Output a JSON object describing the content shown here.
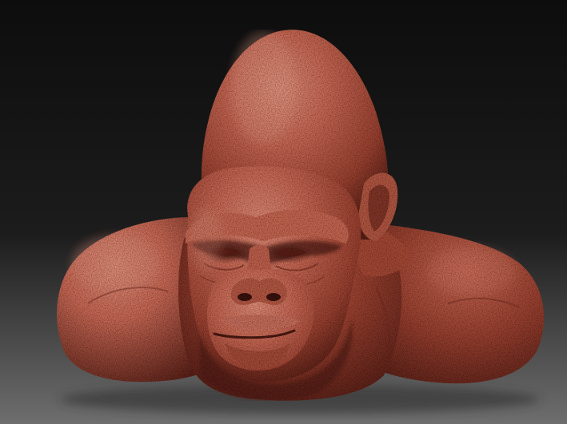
{
  "scene": {
    "subject": "sculpted-gorilla-bust",
    "colors": {
      "background_top": "#0d0d0d",
      "background_mid": "#1c1c1c",
      "background_bottom": "#6e6e6e",
      "clay_base": "#9c4433",
      "clay_light": "#c96c58",
      "clay_highlight": "#e0907c",
      "clay_shadow": "#5a2219",
      "clay_deep": "#3b140e"
    }
  }
}
